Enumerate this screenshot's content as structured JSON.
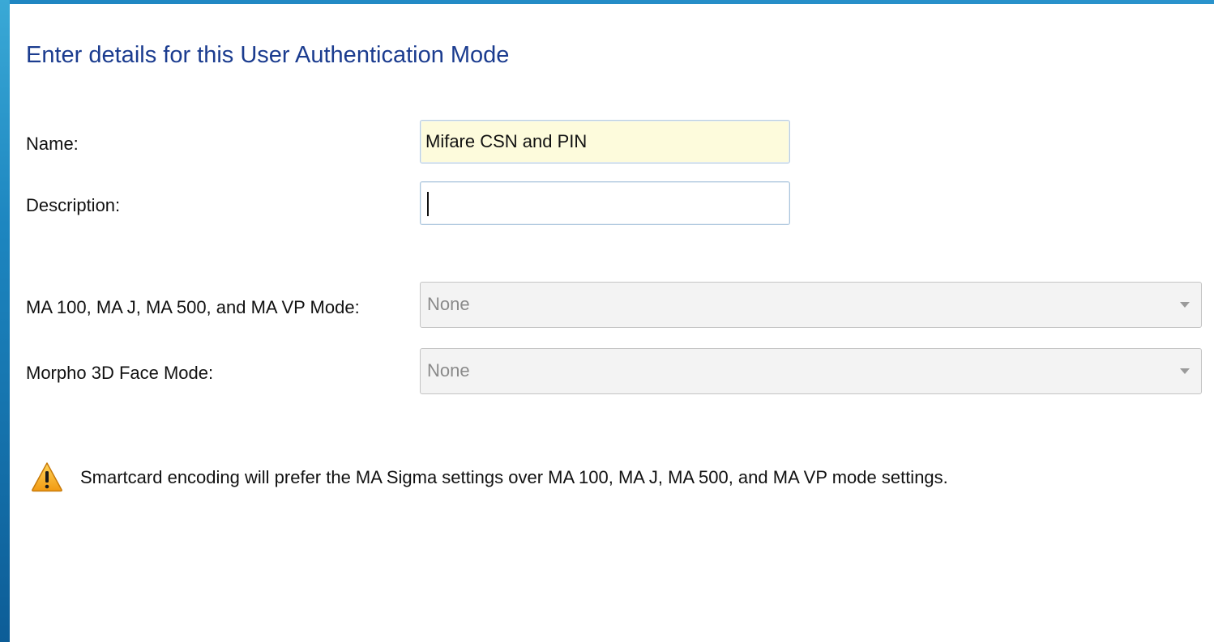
{
  "header": {
    "title": "Enter details for this User Authentication Mode"
  },
  "form": {
    "name": {
      "label": "Name:",
      "value": "Mifare CSN and PIN"
    },
    "description": {
      "label": "Description:",
      "value": ""
    },
    "ma_mode": {
      "label": "MA 100, MA J, MA 500, and MA VP Mode:",
      "selected": "None"
    },
    "morpho_face_mode": {
      "label": "Morpho 3D Face Mode:",
      "selected": "None"
    }
  },
  "warning": {
    "icon": "warning-triangle-icon",
    "text": "Smartcard encoding will prefer the MA Sigma settings over MA 100, MA J, MA 500, and MA VP mode settings."
  },
  "colors": {
    "title": "#1b3c8f",
    "name_field_bg": "#fdfbdc",
    "disabled_select_bg": "#f3f3f3",
    "warning_icon_fill": "#f5a623",
    "frame_accent": "#1d86c0"
  }
}
